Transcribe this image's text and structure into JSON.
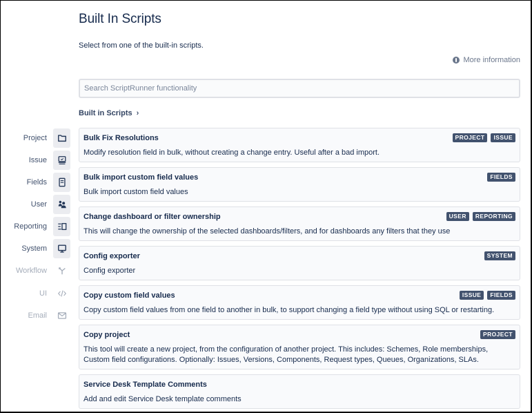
{
  "header": {
    "title": "Built In Scripts",
    "subtitle": "Select from one of the built-in scripts.",
    "more_info": "More information"
  },
  "search": {
    "placeholder": "Search ScriptRunner functionality",
    "value": ""
  },
  "breadcrumb": {
    "label": "Built in Scripts",
    "chevron": "›"
  },
  "sidebar": {
    "items": [
      {
        "label": "Project",
        "icon": "folder-icon",
        "enabled": true
      },
      {
        "label": "Issue",
        "icon": "issue-monitor-icon",
        "enabled": true
      },
      {
        "label": "Fields",
        "icon": "form-icon",
        "enabled": true
      },
      {
        "label": "User",
        "icon": "people-icon",
        "enabled": true
      },
      {
        "label": "Reporting",
        "icon": "reporting-icon",
        "enabled": true
      },
      {
        "label": "System",
        "icon": "screen-icon",
        "enabled": true
      },
      {
        "label": "Workflow",
        "icon": "workflow-branch-icon",
        "enabled": false
      },
      {
        "label": "UI",
        "icon": "code-icon",
        "enabled": false
      },
      {
        "label": "Email",
        "icon": "email-icon",
        "enabled": false
      }
    ]
  },
  "scripts": [
    {
      "title": "Bulk Fix Resolutions",
      "description": "Modify resolution field in bulk, without creating a change entry. Useful after a bad import.",
      "tags": [
        "PROJECT",
        "ISSUE"
      ]
    },
    {
      "title": "Bulk import custom field values",
      "description": "Bulk import custom field values",
      "tags": [
        "FIELDS"
      ]
    },
    {
      "title": "Change dashboard or filter ownership",
      "description": "This will change the ownership of the selected dashboards/filters, and for dashboards any filters that they use",
      "tags": [
        "USER",
        "REPORTING"
      ]
    },
    {
      "title": "Config exporter",
      "description": "Config exporter",
      "tags": [
        "SYSTEM"
      ]
    },
    {
      "title": "Copy custom field values",
      "description": "Copy custom field values from one field to another in bulk, to support changing a field type without using SQL or restarting.",
      "tags": [
        "ISSUE",
        "FIELDS"
      ]
    },
    {
      "title": "Copy project",
      "description": "This tool will create a new project, from the configuration of another project. This includes: Schemes, Role memberships, Custom field configurations. Optionally: Issues, Versions, Components, Request types, Queues, Organizations, SLAs.",
      "tags": [
        "PROJECT"
      ]
    },
    {
      "title": "Service Desk Template Comments",
      "description": "Add and edit Service Desk template comments",
      "tags": []
    }
  ],
  "colors": {
    "tag_bg": "#42526e",
    "text_primary": "#172b4d",
    "card_bg": "#f9fafc",
    "border": "#dfe1e6",
    "disabled": "#a5adba"
  }
}
